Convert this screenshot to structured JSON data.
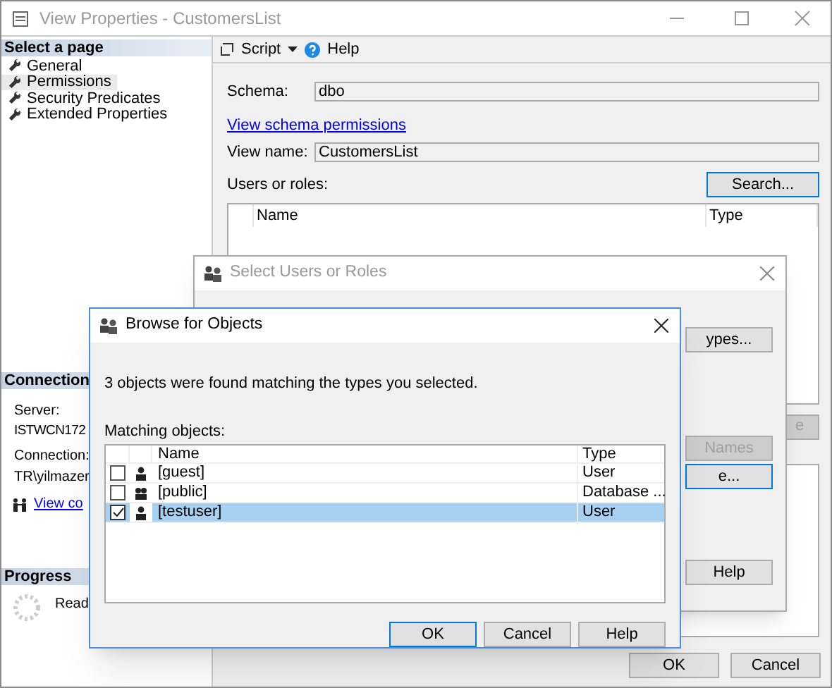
{
  "window": {
    "title": "View Properties - CustomersList"
  },
  "sidebar": {
    "header": "Select a page",
    "items": [
      {
        "label": "General",
        "selected": false
      },
      {
        "label": "Permissions",
        "selected": true
      },
      {
        "label": "Security Predicates",
        "selected": false
      },
      {
        "label": "Extended Properties",
        "selected": false
      }
    ]
  },
  "connection": {
    "header": "Connection",
    "server_label": "Server:",
    "server": "ISTWCN172",
    "connection_label": "Connection:",
    "connection": "TR\\yilmazer",
    "link": "View co"
  },
  "progress": {
    "header": "Progress",
    "status": "Read"
  },
  "toolbar": {
    "script": "Script",
    "help": "Help"
  },
  "form": {
    "schema_label": "Schema:",
    "schema": "dbo",
    "schema_link": "View schema permissions",
    "view_name_label": "View name:",
    "view_name": "CustomersList",
    "users_label": "Users or roles:",
    "search_button": "Search...",
    "columns": [
      "Name",
      "Type"
    ],
    "partial_button": "e"
  },
  "buttons": [
    "OK",
    "Cancel"
  ],
  "select_dialog": {
    "title": "Select Users or Roles",
    "active": false,
    "buttons": [
      {
        "label": "ypes...",
        "disabled": false,
        "default": false
      },
      {
        "label": "Names",
        "disabled": true,
        "default": false
      },
      {
        "label": "e...",
        "disabled": false,
        "default": true
      },
      {
        "label": "Help",
        "disabled": false,
        "default": false
      }
    ]
  },
  "browse_dialog": {
    "title": "Browse for Objects",
    "message": "3 objects were found matching the types you selected.",
    "list_label": "Matching objects:",
    "columns": [
      "Name",
      "Type"
    ],
    "rows": [
      {
        "name": "[guest]",
        "type": "User",
        "kind": "user",
        "checked": false,
        "selected": false
      },
      {
        "name": "[public]",
        "type": "Database ...",
        "kind": "role",
        "checked": false,
        "selected": false
      },
      {
        "name": "[testuser]",
        "type": "User",
        "kind": "user",
        "checked": true,
        "selected": true
      }
    ],
    "buttons": [
      {
        "label": "OK",
        "default": true
      },
      {
        "label": "Cancel",
        "default": false
      },
      {
        "label": "Help",
        "default": false
      }
    ]
  }
}
